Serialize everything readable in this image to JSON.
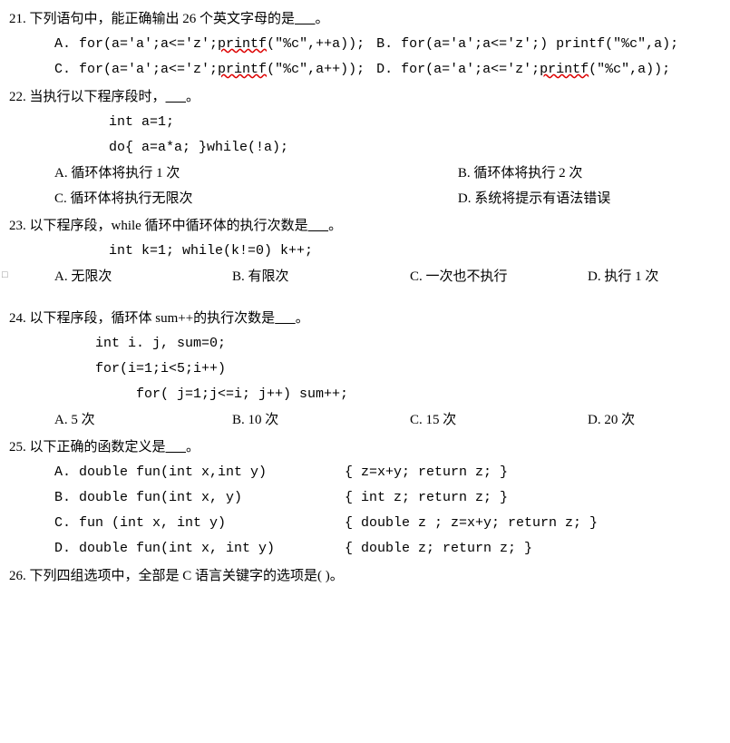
{
  "q21": {
    "stem_prefix": "21.  下列语句中，能正确输出 26 个英文字母的是",
    "stem_suffix": "。",
    "A": {
      "label": "A.  ",
      "pre": "for(a='a';a<='z';",
      "wavy": "printf",
      "post": "(\"%c\",++a));"
    },
    "B": {
      "label": "B.  ",
      "text": "for(a='a';a<='z';) printf(\"%c\",a);"
    },
    "C": {
      "label": "C.  ",
      "pre": "for(a='a';a<='z';",
      "wavy": "printf",
      "post": "(\"%c\",a++));"
    },
    "D": {
      "label": "D.  ",
      "pre": "for(a='a';a<='z';",
      "wavy": "printf",
      "post": "(\"%c\",a));"
    }
  },
  "q22": {
    "stem_prefix": "22.  当执行以下程序段时，",
    "stem_suffix": "。",
    "code1": "int a=1;",
    "code2": "do{   a=a*a;   }while(!a);",
    "A": "A.  循环体将执行 1 次",
    "B": "B.  循环体将执行 2 次",
    "C": "C.  循环体将执行无限次",
    "D": "D.  系统将提示有语法错误"
  },
  "q23": {
    "stem_prefix": "23.  以下程序段，while 循环中循环体的执行次数是",
    "stem_suffix": "。",
    "code": "int  k=1;   while(k!=0) k++;",
    "A": "A.  无限次",
    "B": "B.  有限次",
    "C": "C.  一次也不执行",
    "D": "D.  执行 1 次"
  },
  "q24": {
    "stem_prefix": "24.  以下程序段，循环体 sum++的执行次数是",
    "stem_suffix": "。",
    "code1": "int  i. j, sum=0;",
    "code2": "for(i=1;i<5;i++)",
    "code3": "for( j=1;j<=i;  j++) sum++;",
    "A": "A. 5 次",
    "B": "B.  10 次",
    "C": "C.  15 次",
    "D": "D.  20 次"
  },
  "q25": {
    "stem_prefix": "25.  以下正确的函数定义是",
    "stem_suffix": "。",
    "A1": "A. double   fun(int  x,int  y)",
    "A2": "{  z=x+y;        return z;  }",
    "B1": "B. double   fun(int  x, y)",
    "B2": "{  int z;        return z;  }",
    "C1": "C. fun (int  x, int  y)",
    "C2": "{  double z ; z=x+y;  return z;  }",
    "D1": "D. double   fun(int  x, int  y)",
    "D2": "{  double z;         return z;  }"
  },
  "q26": {
    "stem": "26. 下列四组选项中，全部是 C 语言关键字的选项是( )。"
  },
  "blank": "      "
}
